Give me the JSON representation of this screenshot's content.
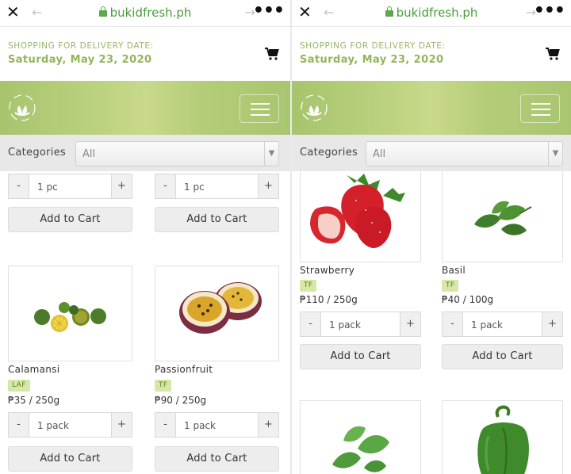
{
  "screens": [
    {
      "browser": {
        "domain": "bukidfresh.ph"
      },
      "delivery": {
        "label": "SHOPPING FOR DELIVERY DATE:",
        "date": "Saturday, May 23, 2020"
      },
      "categories": {
        "label": "Categories",
        "selected": "All"
      },
      "top_row": [
        {
          "qty": "1 pc",
          "add_label": "Add to Cart"
        },
        {
          "qty": "1 pc",
          "add_label": "Add to Cart"
        }
      ],
      "products": [
        {
          "name": "Calamansi",
          "tag": "LAF",
          "price": "₱35 / 250g",
          "qty": "1 pack",
          "add_label": "Add to Cart"
        },
        {
          "name": "Passionfruit",
          "tag": "TF",
          "price": "₱90 / 250g",
          "qty": "1 pack",
          "add_label": "Add to Cart"
        }
      ]
    },
    {
      "browser": {
        "domain": "bukidfresh.ph"
      },
      "delivery": {
        "label": "SHOPPING FOR DELIVERY DATE:",
        "date": "Saturday, May 23, 2020"
      },
      "categories": {
        "label": "Categories",
        "selected": "All"
      },
      "products": [
        {
          "name": "Strawberry",
          "tag": "TF",
          "price": "₱110 / 250g",
          "qty": "1 pack",
          "add_label": "Add to Cart"
        },
        {
          "name": "Basil",
          "tag": "TF",
          "price": "₱40 / 100g",
          "qty": "1 pack",
          "add_label": "Add to Cart"
        }
      ]
    }
  ],
  "icons": {
    "close": "close-icon",
    "back": "arrow-left-icon",
    "forward": "arrow-right-icon",
    "more": "more-dots-icon",
    "lock": "lock-icon",
    "cart": "cart-icon",
    "menu": "hamburger-menu-icon",
    "logo": "bukid-fresh-logo"
  },
  "colors": {
    "accent_green": "#93b558",
    "banner_green": "#b4cc78",
    "tag_bg": "#d6e8a6",
    "url_green": "#4b9b3b"
  }
}
